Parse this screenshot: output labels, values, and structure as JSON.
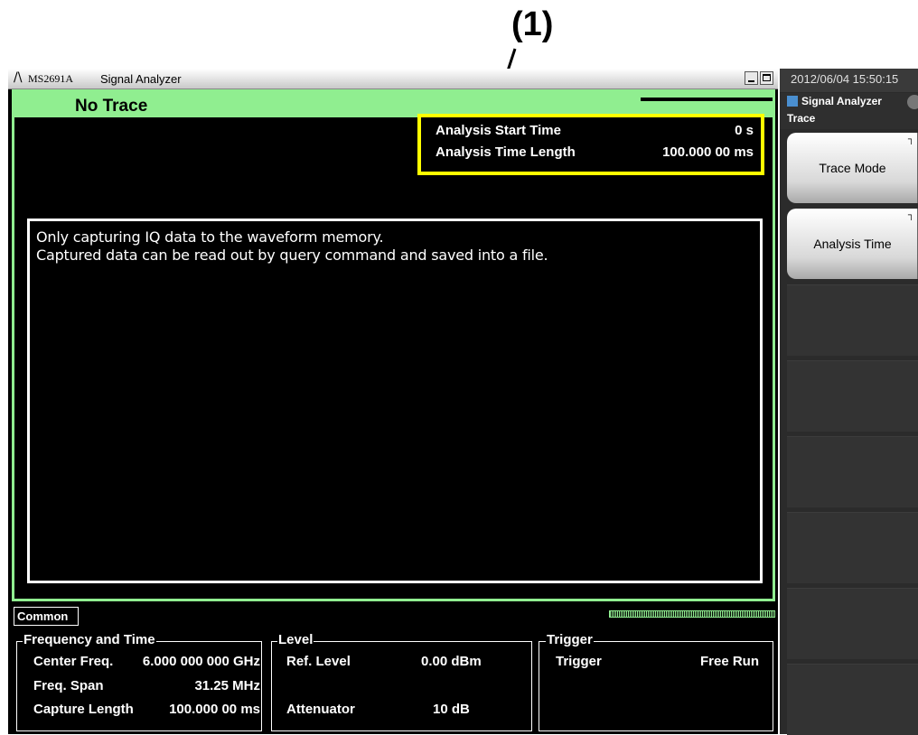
{
  "callout": {
    "label": "(1)"
  },
  "window": {
    "model": "MS2691A",
    "app_title": "Signal Analyzer"
  },
  "trace": {
    "title": "No Trace",
    "analysis": {
      "start_label": "Analysis Start Time",
      "start_value": "0 s",
      "length_label": "Analysis Time Length",
      "length_value": "100.000 00 ms"
    },
    "message": {
      "line1": "Only capturing IQ data to the waveform memory.",
      "line2": "Captured data can be read out by query command and saved into a file."
    }
  },
  "common": {
    "tab_label": "Common",
    "frequency_time": {
      "title": "Frequency and Time",
      "center_label": "Center Freq.",
      "center_value": "6.000 000 000 GHz",
      "span_label": "Freq. Span",
      "span_value": "31.25 MHz",
      "capture_label": "Capture Length",
      "capture_value": "100.000 00 ms"
    },
    "level": {
      "title": "Level",
      "ref_label": "Ref. Level",
      "ref_value": "0.00 dBm",
      "att_label": "Attenuator",
      "att_value": "10 dB"
    },
    "trigger": {
      "title": "Trigger",
      "trigger_label": "Trigger",
      "trigger_value": "Free Run"
    }
  },
  "side_panel": {
    "datetime": "2012/06/04 15:50:15",
    "app_name": "Signal Analyzer",
    "menu_name": "Trace",
    "soft_keys": [
      "Trace Mode",
      "Analysis Time"
    ]
  },
  "colors": {
    "highlight": "#ffff00",
    "panel_green": "#90ee90"
  }
}
